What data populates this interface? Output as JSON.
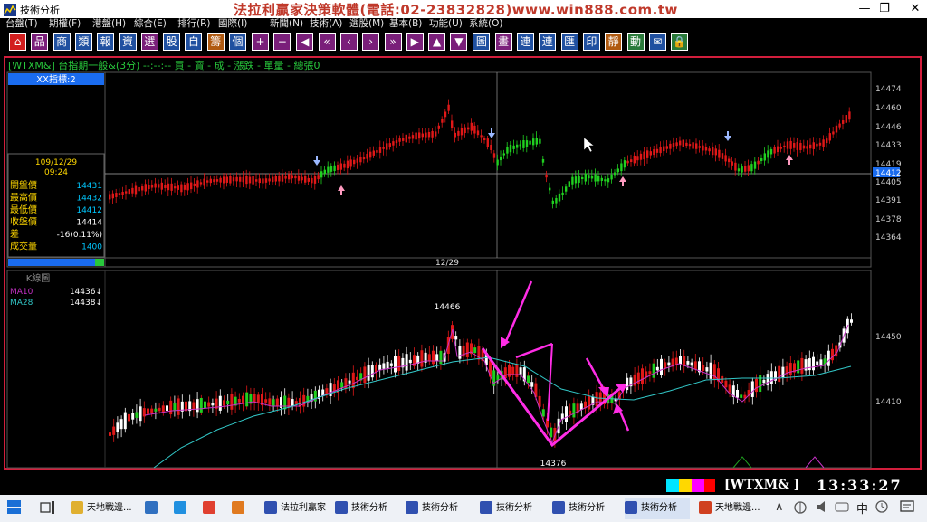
{
  "window": {
    "title": "技術分析",
    "banner": "法拉利贏家決策軟體(電話:02-23832828)www.win888.com.tw",
    "controls": [
      "—",
      "❐",
      "✕"
    ]
  },
  "menu": [
    "台盤(T)",
    "期權(F)",
    "港盤(H)",
    "綜合(E)",
    "排行(R)",
    "國際(I)",
    "新聞(N)",
    "技術(A)",
    "選股(M)",
    "基本(B)",
    "功能(U)",
    "系統(O)"
  ],
  "toolbar": [
    {
      "glyph": "⌂",
      "icon": "home-icon",
      "color": "#d21e1e"
    },
    {
      "glyph": "品",
      "icon": "product-icon",
      "color": "#7a1f7a"
    },
    {
      "glyph": "商",
      "icon": "commodity-icon",
      "color": "#2050a0"
    },
    {
      "glyph": "類",
      "icon": "category-icon",
      "color": "#2050a0"
    },
    {
      "glyph": "報",
      "icon": "quote-icon",
      "color": "#2050a0"
    },
    {
      "glyph": "資",
      "icon": "data-icon",
      "color": "#2050a0"
    },
    {
      "glyph": "選",
      "icon": "select-icon",
      "color": "#7a1f7a"
    },
    {
      "glyph": "股",
      "icon": "stock-icon",
      "color": "#2050a0"
    },
    {
      "glyph": "自",
      "icon": "custom-icon",
      "color": "#2050a0"
    },
    {
      "glyph": "籌",
      "icon": "chips-icon",
      "color": "#b05a10"
    },
    {
      "glyph": "個",
      "icon": "single-icon",
      "color": "#2050a0"
    },
    {
      "glyph": "+",
      "icon": "plus-icon",
      "color": "#7a1f7a"
    },
    {
      "glyph": "−",
      "icon": "minus-icon",
      "color": "#7a1f7a"
    },
    {
      "glyph": "◀",
      "icon": "left-icon",
      "color": "#7a1f7a"
    },
    {
      "glyph": "«",
      "icon": "fast-left-icon",
      "color": "#7a1f7a"
    },
    {
      "glyph": "‹",
      "icon": "prev-icon",
      "color": "#7a1f7a"
    },
    {
      "glyph": "›",
      "icon": "next-icon",
      "color": "#7a1f7a"
    },
    {
      "glyph": "»",
      "icon": "fast-right-icon",
      "color": "#7a1f7a"
    },
    {
      "glyph": "▶",
      "icon": "right-icon",
      "color": "#7a1f7a"
    },
    {
      "glyph": "▲",
      "icon": "up-icon",
      "color": "#7a1f7a"
    },
    {
      "glyph": "▼",
      "icon": "down-icon",
      "color": "#7a1f7a"
    },
    {
      "glyph": "圖",
      "icon": "chart-icon",
      "color": "#2050a0"
    },
    {
      "glyph": "畫",
      "icon": "draw-icon",
      "color": "#7a1f7a"
    },
    {
      "glyph": "連",
      "icon": "link-icon",
      "color": "#2050a0"
    },
    {
      "glyph": "連",
      "icon": "link2-icon",
      "color": "#2050a0"
    },
    {
      "glyph": "匯",
      "icon": "export-icon",
      "color": "#2050a0"
    },
    {
      "glyph": "印",
      "icon": "print-icon",
      "color": "#2050a0"
    },
    {
      "glyph": "靜",
      "icon": "static-icon",
      "color": "#b05a10"
    },
    {
      "glyph": "動",
      "icon": "dynamic-icon",
      "color": "#2a7a3a"
    },
    {
      "glyph": "✉",
      "icon": "message-icon",
      "color": "#2050a0"
    },
    {
      "glyph": "🔒",
      "icon": "lock-icon",
      "color": "#2a7a3a"
    }
  ],
  "chart": {
    "header": "[WTXM&] 台指期一般&(3分)  --:--:-- 買 - 賣 - 成 - 漲跌 - 單量 - 總張0",
    "indicator_label": "XX指標:2",
    "kline_label": "K線圖",
    "date_label": "12/29",
    "info": {
      "date": "109/12/29",
      "time": "09:24",
      "rows": [
        {
          "label": "開盤價",
          "value": "14431",
          "color": "#00c8ff"
        },
        {
          "label": "最高價",
          "value": "14432",
          "color": "#00c8ff"
        },
        {
          "label": "最低價",
          "value": "14412",
          "color": "#00c8ff"
        },
        {
          "label": "收盤價",
          "value": "14414",
          "color": "#ffffff"
        },
        {
          "label": "差",
          "value": "-16(0.11%)",
          "color": "#ffffff"
        },
        {
          "label": "成交量",
          "value": "1400",
          "color": "#00c8ff"
        }
      ]
    },
    "ma": [
      {
        "label": "MA10",
        "value": "14436↓",
        "color": "#c832c8"
      },
      {
        "label": "MA28",
        "value": "14438↓",
        "color": "#32c8c8"
      }
    ],
    "upper_axis": [
      "14474",
      "14460",
      "14446",
      "14433",
      "14419",
      "14412",
      "14405",
      "14391",
      "14378",
      "14364"
    ],
    "lower_axis": [
      "14450",
      "14410"
    ],
    "annotations": {
      "high": "14466",
      "low": "14376"
    }
  },
  "chart_data": {
    "type": "candlestick",
    "upper_panel": {
      "ylim": [
        14364,
        14474
      ],
      "current_price": 14412
    },
    "lower_panel": {
      "high_marker": 14466,
      "low_marker": 14376,
      "series": [
        "MA10",
        "MA28"
      ]
    }
  },
  "status": {
    "code": "[WTXM&  ]",
    "time": "13:33:27"
  },
  "taskbar": [
    {
      "label": "天地戰邊...",
      "icon": "folder-icon",
      "color": "#e0b030"
    },
    {
      "label": "",
      "icon": "computer-icon",
      "color": "#3070c0"
    },
    {
      "label": "",
      "icon": "ie-icon",
      "color": "#2090e0"
    },
    {
      "label": "",
      "icon": "chrome-icon",
      "color": "#e04030"
    },
    {
      "label": "",
      "icon": "firefox-icon",
      "color": "#e07a20"
    },
    {
      "label": "法拉利贏家",
      "icon": "ferrari-icon",
      "color": "#3050b0"
    },
    {
      "label": "技術分析",
      "icon": "ta-icon",
      "color": "#3050b0"
    },
    {
      "label": "技術分析",
      "icon": "ta-icon",
      "color": "#3050b0"
    },
    {
      "label": "技術分析",
      "icon": "ta-icon",
      "color": "#3050b0"
    },
    {
      "label": "技術分析",
      "icon": "ta-icon",
      "color": "#3050b0"
    },
    {
      "label": "技術分析",
      "icon": "ta-icon",
      "color": "#3050b0"
    },
    {
      "label": "天地戰邊...",
      "icon": "ppt-icon",
      "color": "#d04020"
    }
  ],
  "tray": {
    "lang": "中",
    "time_icon": "clock-icon"
  }
}
